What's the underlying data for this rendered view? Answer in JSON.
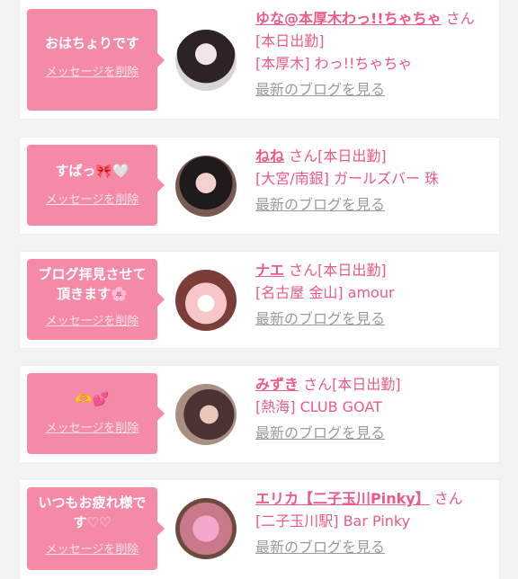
{
  "delete_label": "メッセージを削除",
  "blog_label": "最新のブログを見る",
  "san": "さん",
  "today": "[本日出勤]",
  "cards": [
    {
      "message": "おはちょりです",
      "name": "ゆな@本厚木わっ!!ちゃちゃ",
      "area": "[本厚木] わっ!!ちゃちゃ"
    },
    {
      "message": "すぱっ",
      "icons": "🎀🤍",
      "name": "ねね",
      "area": "[大宮/南銀] ガールズバー 珠"
    },
    {
      "message_1": "ブログ拝見させて",
      "message_2": "頂きます",
      "icons": "🌸",
      "name": "ナエ",
      "area": "[名古屋 金山] amour"
    },
    {
      "icons": "🫶💕",
      "name": "みずき",
      "area": "[熱海] CLUB GOAT"
    },
    {
      "message_1": "いつもお疲れ様で",
      "message_2": "す",
      "icons": "♡♡",
      "name": "エリカ【二子玉川Pinky】",
      "area": "[二子玉川駅] Bar Pinky"
    }
  ],
  "colors": {
    "accent": "#ee5a86",
    "bubble": "#f58aa8",
    "link_gray": "#9a9a9a",
    "background": "#f3f3f3"
  }
}
